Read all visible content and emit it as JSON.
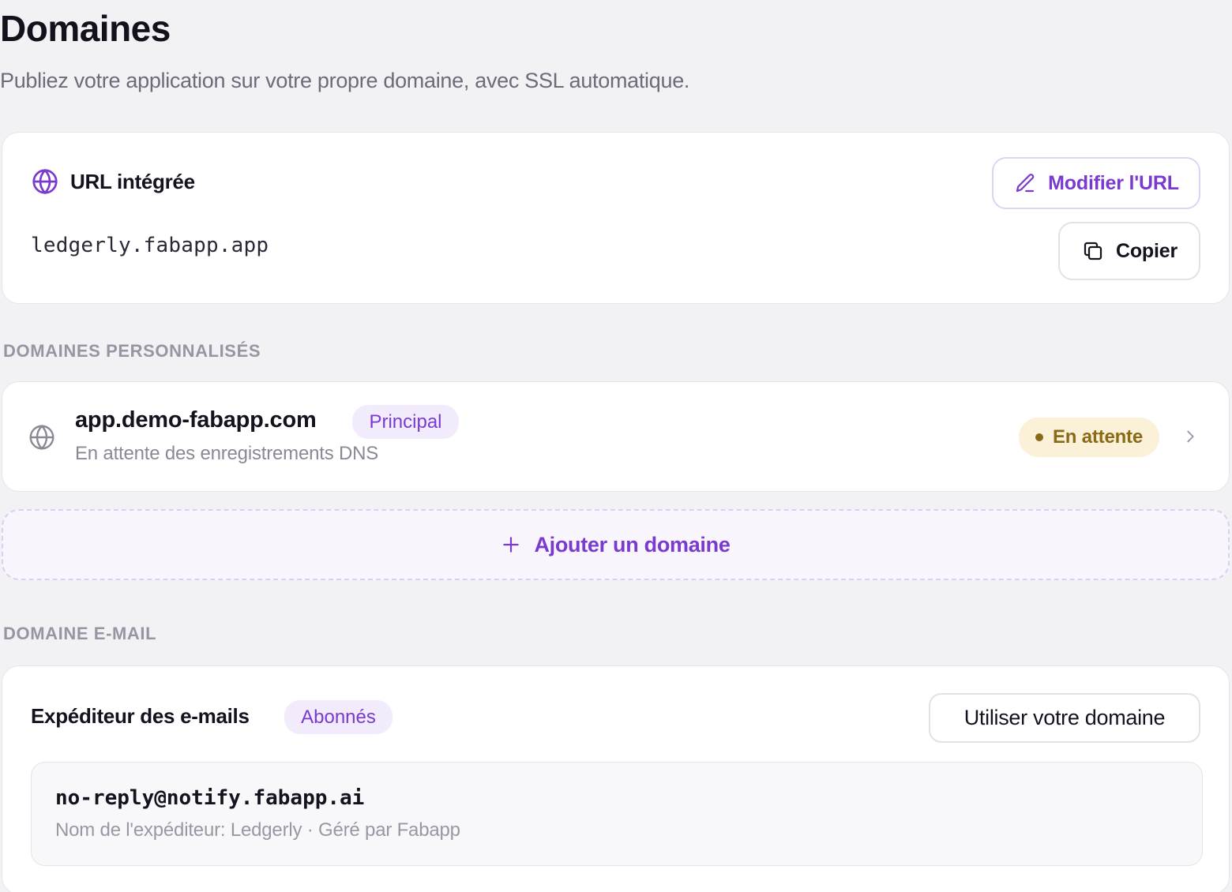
{
  "page": {
    "title": "Domaines",
    "subtitle": "Publiez votre application sur votre propre domaine, avec SSL automatique."
  },
  "builtin_url": {
    "label": "URL intégrée",
    "value": "ledgerly.fabapp.app",
    "edit_label": "Modifier l'URL",
    "copy_label": "Copier"
  },
  "custom_domains": {
    "section_label": "DOMAINES PERSONNALISÉS",
    "items": [
      {
        "name": "app.demo-fabapp.com",
        "badge": "Principal",
        "subtitle": "En attente des enregistrements DNS",
        "status": "En attente"
      }
    ],
    "add_label": "Ajouter un domaine"
  },
  "email_domain": {
    "section_label": "DOMAINE E-MAIL",
    "sender_label": "Expéditeur des e-mails",
    "badge": "Abonnés",
    "use_own_label": "Utiliser votre domaine",
    "address": "no-reply@notify.fabapp.ai",
    "meta": "Nom de l'expéditeur: Ledgerly · Géré par Fabapp"
  },
  "colors": {
    "accent": "#7a3ad0",
    "background": "#f2f2f5",
    "pending_bg": "#fbf1d9",
    "pending_text": "#8a6a16"
  },
  "icons": {
    "builtin": "globe-icon",
    "edit": "pencil-icon",
    "copy": "copy-icon",
    "domain": "globe-icon",
    "row_action": "chevron-right-icon",
    "add": "plus-icon"
  }
}
